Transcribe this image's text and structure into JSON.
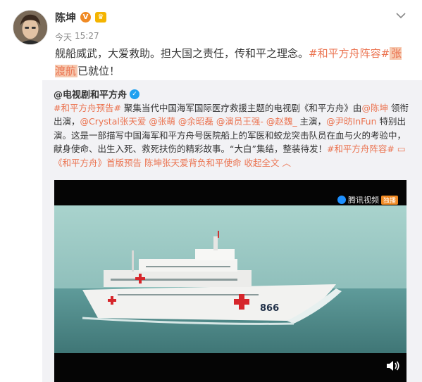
{
  "post": {
    "author": "陈坤",
    "verified_badge": "V",
    "time_relative": "今天",
    "time_clock": "15:27",
    "text_lead": "舰船威武，大爱救助。担大国之责任，传和平之理念。",
    "tag_cast": "#和平方舟阵容#",
    "highlight_name": "张渡航",
    "text_tail": "已就位！"
  },
  "repost": {
    "author": "@电视剧和平方舟",
    "tag_trailer": "#和平方舟预告#",
    "text_1": " 聚集当代中国海军国际医疗救援主题的电视剧《和平方舟》由",
    "mention_lead": "@陈坤",
    "text_2": " 领衔出演，",
    "mention_2": "@Crystal张天爱",
    "mention_3": "@张萌",
    "mention_4": "@余昭磊",
    "mention_5": "@演员王强-",
    "mention_6": "@赵魏_",
    "text_3": " 主演，",
    "mention_7": "@尹昉InFun",
    "text_4": " 特别出演。这是一部描写中国海军和平方舟号医院船上的军医和蛟龙突击队员在血与火的考验中，献身使命、出生入死、救死扶伤的精彩故事。“大白”集结，整装待发！",
    "tag_cast": "#和平方舟阵容#",
    "video_link": "《和平方舟》首版预告 陈坤张天爱背负和平使命",
    "fold_label": "收起全文"
  },
  "video": {
    "watermark": "腾讯视频",
    "watermark_badge": "独播",
    "hull_number": "866"
  },
  "colors": {
    "accent": "#eb7350",
    "sea": "#4f8a8b",
    "sky": "#9ccac6"
  }
}
